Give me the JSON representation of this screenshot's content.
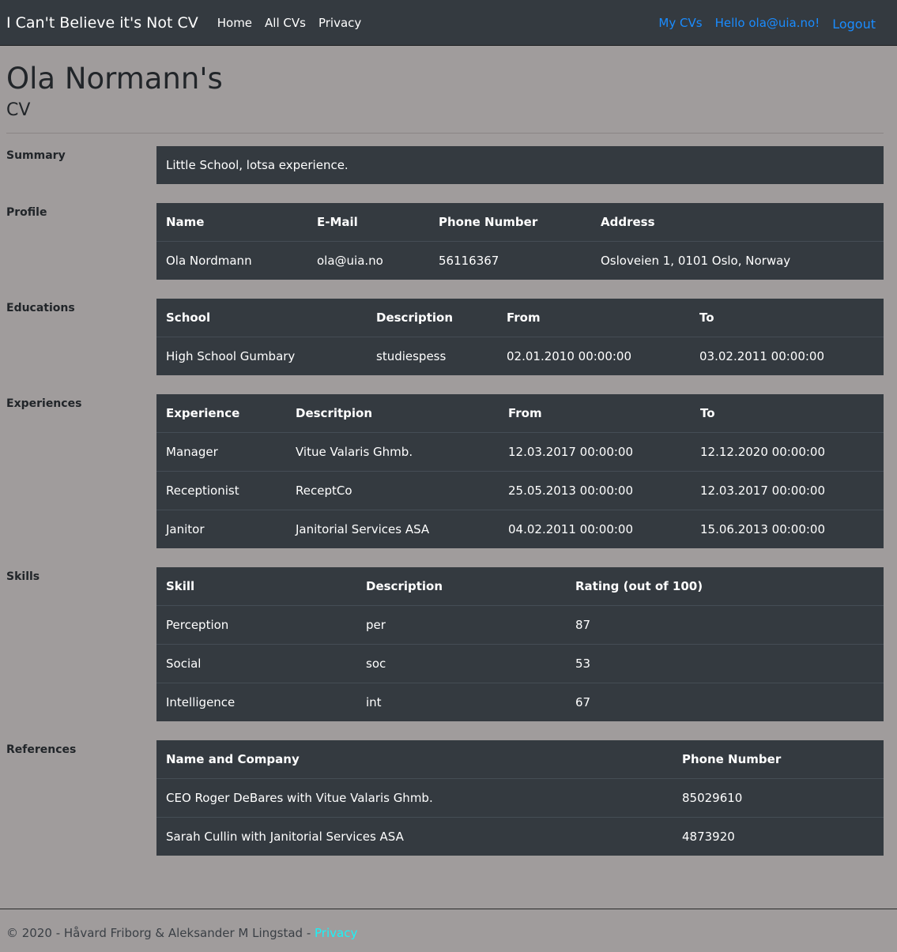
{
  "nav": {
    "brand": "I Can't Believe it's Not CV",
    "links": [
      "Home",
      "All CVs",
      "Privacy"
    ],
    "my_cvs": "My CVs",
    "hello": "Hello ola@uia.no!",
    "logout": "Logout"
  },
  "page": {
    "title": "Ola Normann's",
    "subtitle": "CV"
  },
  "summary": {
    "label": "Summary",
    "text": "Little School, lotsa experience."
  },
  "profile": {
    "label": "Profile",
    "headers": [
      "Name",
      "E-Mail",
      "Phone Number",
      "Address"
    ],
    "row": [
      "Ola Nordmann",
      "ola@uia.no",
      "56116367",
      "Osloveien 1, 0101 Oslo, Norway"
    ]
  },
  "educations": {
    "label": "Educations",
    "headers": [
      "School",
      "Description",
      "From",
      "To"
    ],
    "rows": [
      [
        "High School Gumbary",
        "studiespess",
        "02.01.2010 00:00:00",
        "03.02.2011 00:00:00"
      ]
    ]
  },
  "experiences": {
    "label": "Experiences",
    "headers": [
      "Experience",
      "Descritpion",
      "From",
      "To"
    ],
    "rows": [
      [
        "Manager",
        "Vitue Valaris Ghmb.",
        "12.03.2017 00:00:00",
        "12.12.2020 00:00:00"
      ],
      [
        "Receptionist",
        "ReceptCo",
        "25.05.2013 00:00:00",
        "12.03.2017 00:00:00"
      ],
      [
        "Janitor",
        "Janitorial Services ASA",
        "04.02.2011 00:00:00",
        "15.06.2013 00:00:00"
      ]
    ]
  },
  "skills": {
    "label": "Skills",
    "headers": [
      "Skill",
      "Description",
      "Rating (out of 100)"
    ],
    "rows": [
      [
        "Perception",
        "per",
        "87"
      ],
      [
        "Social",
        "soc",
        "53"
      ],
      [
        "Intelligence",
        "int",
        "67"
      ]
    ]
  },
  "references": {
    "label": "References",
    "headers": [
      "Name and Company",
      "Phone Number"
    ],
    "rows": [
      [
        "CEO Roger DeBares with Vitue Valaris Ghmb.",
        "85029610"
      ],
      [
        "Sarah Cullin with Janitorial Services ASA",
        "4873920"
      ]
    ]
  },
  "footer": {
    "text": "© 2020 - Håvard Friborg & Aleksander M Lingstad - ",
    "privacy": "Privacy"
  }
}
